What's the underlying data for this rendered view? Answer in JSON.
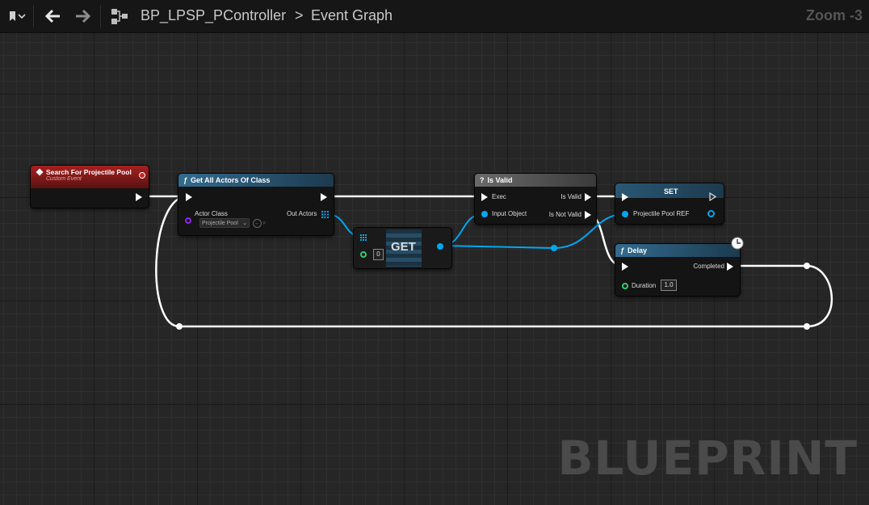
{
  "toolbar": {
    "breadcrumb_blueprint": "BP_LPSP_PController",
    "breadcrumb_separator": ">",
    "breadcrumb_graph": "Event Graph",
    "zoom": "Zoom -3",
    "icons": [
      "bookmark-icon",
      "chevron-down-icon",
      "back-arrow-icon",
      "forward-arrow-icon",
      "graph-hierarchy-icon"
    ]
  },
  "nodes": {
    "custom_event": {
      "title": "Search For Projectile Pool",
      "subtitle": "Custom Event",
      "header_color": "#8b1a1a"
    },
    "get_all_actors": {
      "title": "Get All Actors Of Class",
      "actor_class_label": "Actor Class",
      "actor_class_value": "Projectile Pool",
      "out_actors_label": "Out Actors",
      "header_color": "#2f5d7c"
    },
    "get": {
      "title": "GET",
      "index_value": "0"
    },
    "is_valid": {
      "title": "Is Valid",
      "exec_label": "Exec",
      "input_object_label": "Input Object",
      "is_valid_label": "Is Valid",
      "is_not_valid_label": "Is Not Valid",
      "header_color": "#555555"
    },
    "set": {
      "title": "SET",
      "var_label": "Projectile Pool REF",
      "header_color": "#1f4a63"
    },
    "delay": {
      "title": "Delay",
      "completed_label": "Completed",
      "duration_label": "Duration",
      "duration_value": "1.0",
      "header_color": "#2f5d7c"
    }
  },
  "colors": {
    "exec_wire": "#ffffff",
    "object_wire": "#00a8f0",
    "class_pin": "#8a2be2",
    "float_pin": "#2ecc71"
  },
  "watermark": "BLUEPRINT"
}
